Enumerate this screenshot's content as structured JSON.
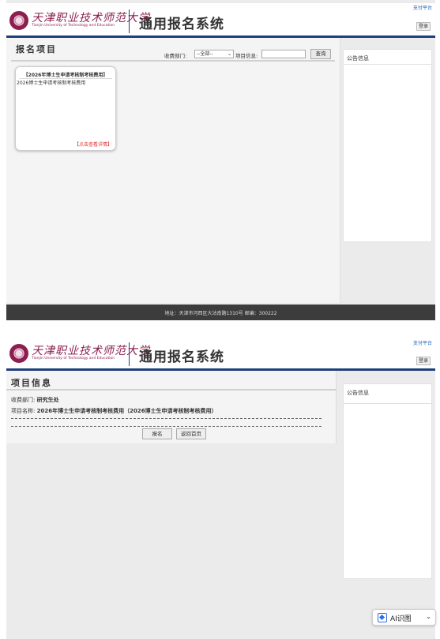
{
  "header": {
    "logo_cn": "天津职业技术师范大学",
    "logo_en": "Tianjin University of Technology and Education",
    "system_title": "通用报名系统",
    "pay_platform": "支付平台",
    "login_label": "登录"
  },
  "list_page": {
    "section_title": "报名项目",
    "department_label": "收费部门:",
    "department_selected": "--全部--",
    "item_info_label": "项目信息:",
    "search_value": "",
    "search_button": "查询",
    "cards": [
      {
        "title": "【2026年博士生申请考核制考核费用】",
        "description": "2026博士生申请考核制考核费用",
        "details_link": "【点击查看详情】"
      }
    ],
    "notice_title": "公告信息",
    "footer_text": "地址：天津市河西区大沽南路1310号 邮编：300222"
  },
  "detail_page": {
    "section_title": "项目信息",
    "department_label": "收费部门:",
    "department_value": "研究生处",
    "item_name_label": "项目名称:",
    "item_name_value": "2026年博士生申请考核制考核费用（2026博士生申请考核制考核费用）",
    "register_button": "报名",
    "back_button": "返回首页",
    "notice_title": "公告信息"
  },
  "ai_widget": {
    "label": "AI识图",
    "icon": "ai-scan-icon"
  }
}
